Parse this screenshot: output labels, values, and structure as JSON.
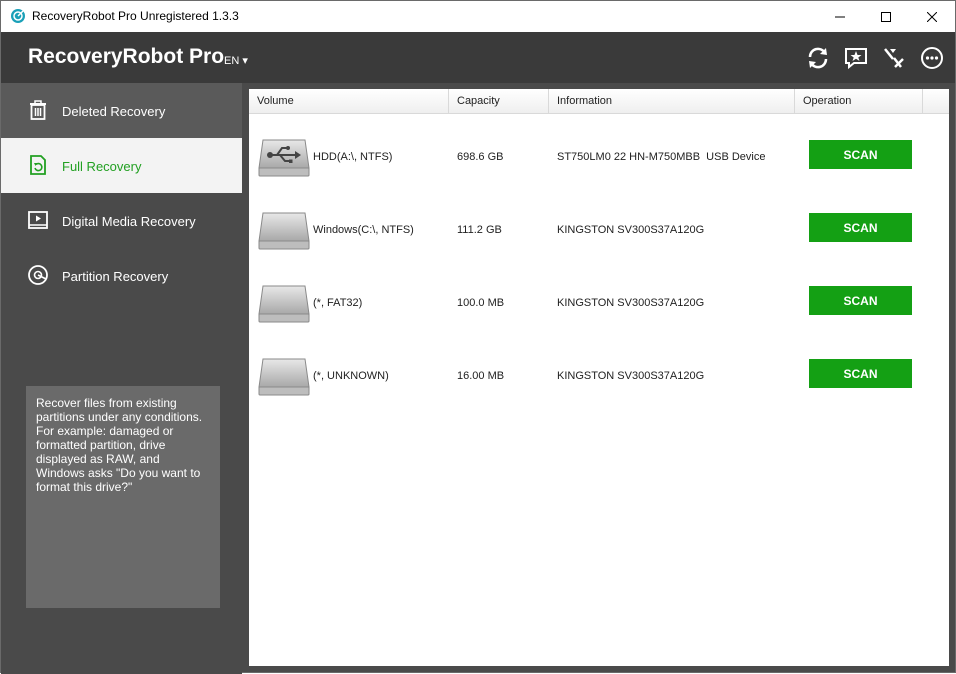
{
  "window": {
    "title": "RecoveryRobot Pro Unregistered 1.3.3"
  },
  "header": {
    "brand": "RecoveryRobot Pro",
    "language": "EN ▾",
    "icons": [
      "refresh-icon",
      "feedback-icon",
      "tools-icon",
      "more-icon"
    ]
  },
  "sidebar": {
    "items": [
      {
        "label": "Deleted Recovery",
        "icon": "trash-icon",
        "active": false
      },
      {
        "label": "Full Recovery",
        "icon": "file-refresh-icon",
        "active": true
      },
      {
        "label": "Digital Media Recovery",
        "icon": "media-icon",
        "active": false
      },
      {
        "label": "Partition Recovery",
        "icon": "partition-icon",
        "active": false
      }
    ],
    "description": "Recover files from existing partitions under any conditions. For example: damaged or formatted partition, drive displayed as RAW, and Windows asks \"Do you want to format this drive?\""
  },
  "table": {
    "columns": [
      "Volume",
      "Capacity",
      "Information",
      "Operation"
    ],
    "rows": [
      {
        "volume": "HDD(A:\\, NTFS)",
        "capacity": "698.6 GB",
        "information": "ST750LM0 22 HN-M750MBB  USB Device",
        "action": "SCAN",
        "icon": "usb-drive-icon"
      },
      {
        "volume": "Windows(C:\\, NTFS)",
        "capacity": "111.2 GB",
        "information": "KINGSTON SV300S37A120G",
        "action": "SCAN",
        "icon": "hard-drive-icon"
      },
      {
        "volume": "(*, FAT32)",
        "capacity": "100.0 MB",
        "information": "KINGSTON SV300S37A120G",
        "action": "SCAN",
        "icon": "hard-drive-icon"
      },
      {
        "volume": "(*, UNKNOWN)",
        "capacity": "16.00 MB",
        "information": "KINGSTON SV300S37A120G",
        "action": "SCAN",
        "icon": "hard-drive-icon"
      }
    ]
  },
  "colors": {
    "accent_green": "#14a014",
    "header_bg": "#3a3a3a",
    "sidebar_bg": "#4a4a4a"
  }
}
